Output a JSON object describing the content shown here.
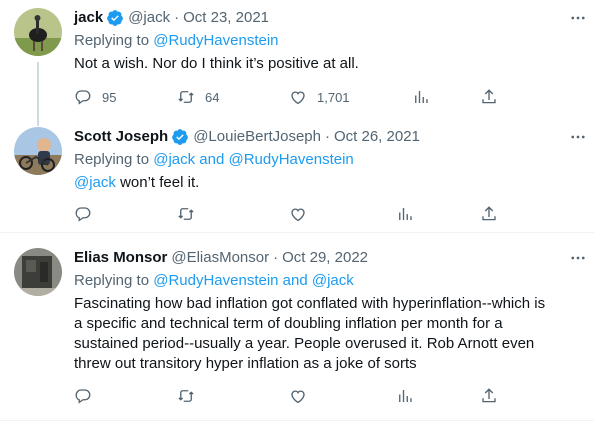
{
  "colors": {
    "accent": "#1d9bf0",
    "muted": "#536471",
    "text": "#0f1419",
    "verified": "#1d9bf0"
  },
  "tweets": [
    {
      "name": "jack",
      "verified": true,
      "handle": "@jack",
      "dot": "·",
      "date": "Oct 23, 2021",
      "replying_prefix": "Replying to ",
      "replying_to": "@RudyHavenstein",
      "body": "Not a wish. Nor do I think it’s positive at all.",
      "replies": "95",
      "retweets": "64",
      "likes": "1,701"
    },
    {
      "name": "Scott Joseph",
      "verified": true,
      "handle": "@LouieBertJoseph",
      "dot": "·",
      "date": "Oct 26, 2021",
      "replying_prefix": "Replying to ",
      "replying_to": "@jack and @RudyHavenstein",
      "body_mention": "@jack",
      "body": " won’t feel it."
    },
    {
      "name": "Elias Monsor",
      "verified": false,
      "handle": "@EliasMonsor",
      "dot": "·",
      "date": "Oct 29, 2022",
      "replying_prefix": "Replying to ",
      "replying_to": "@RudyHavenstein and @jack",
      "body_lines": [
        "Fascinating how bad inflation got conflated with hyperinflation--which is",
        "a specific and technical term of doubling inflation per month for a",
        "sustained period--usually a year. People overused it. Rob Arnott even",
        "threw out transitory hyper inflation as a joke of sorts"
      ]
    }
  ],
  "icons": {
    "reply": "reply-icon",
    "retweet": "retweet-icon",
    "like": "heart-icon",
    "views": "views-chart-icon",
    "share": "share-icon",
    "more": "more-icon",
    "verified": "verified-badge-icon"
  }
}
